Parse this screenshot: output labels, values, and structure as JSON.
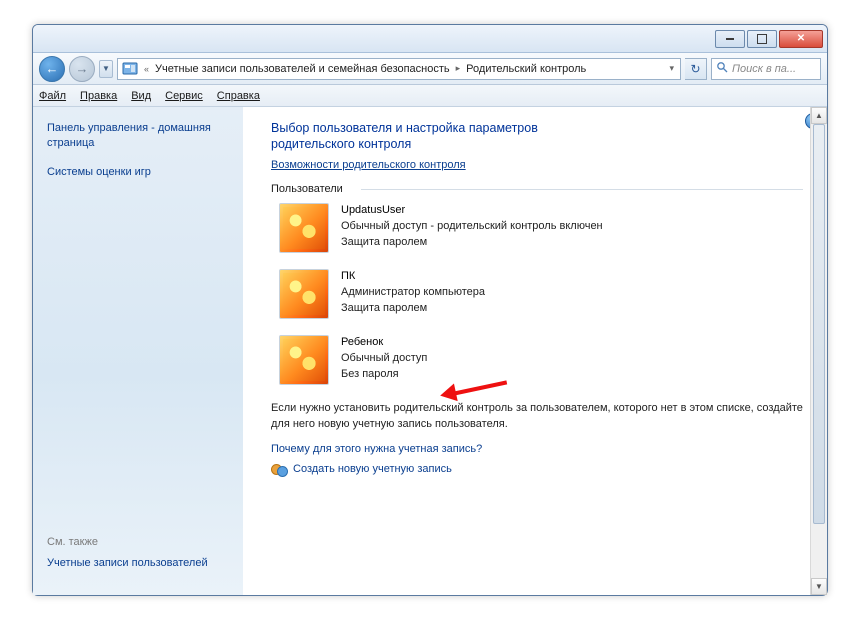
{
  "titlebar": {},
  "nav": {
    "breadcrumb1": "Учетные записи пользователей и семейная безопасность",
    "breadcrumb2": "Родительский контроль",
    "search_placeholder": "Поиск в па..."
  },
  "menu": {
    "file": "Файл",
    "edit": "Правка",
    "view": "Вид",
    "tools": "Сервис",
    "help": "Справка"
  },
  "sidebar": {
    "home": "Панель управления - домашняя страница",
    "ratings": "Системы оценки игр",
    "seealso": "См. также",
    "accounts": "Учетные записи пользователей"
  },
  "main": {
    "heading1": "Выбор пользователя и настройка параметров",
    "heading2": "родительского контроля",
    "capabilities_link": "Возможности родительского контроля",
    "users_label": "Пользователи",
    "note": "Если нужно установить родительский контроль за пользователем, которого нет в этом списке, создайте для него новую учетную запись пользователя.",
    "why_link": "Почему для этого нужна учетная запись?",
    "create_link": "Создать новую учетную запись"
  },
  "users": [
    {
      "name": "UpdatusUser",
      "line1": "Обычный доступ - родительский контроль включен",
      "line2": "Защита паролем"
    },
    {
      "name": "ПК",
      "line1": "Администратор компьютера",
      "line2": "Защита паролем"
    },
    {
      "name": "Ребенок",
      "line1": "Обычный доступ",
      "line2": "Без пароля"
    }
  ]
}
